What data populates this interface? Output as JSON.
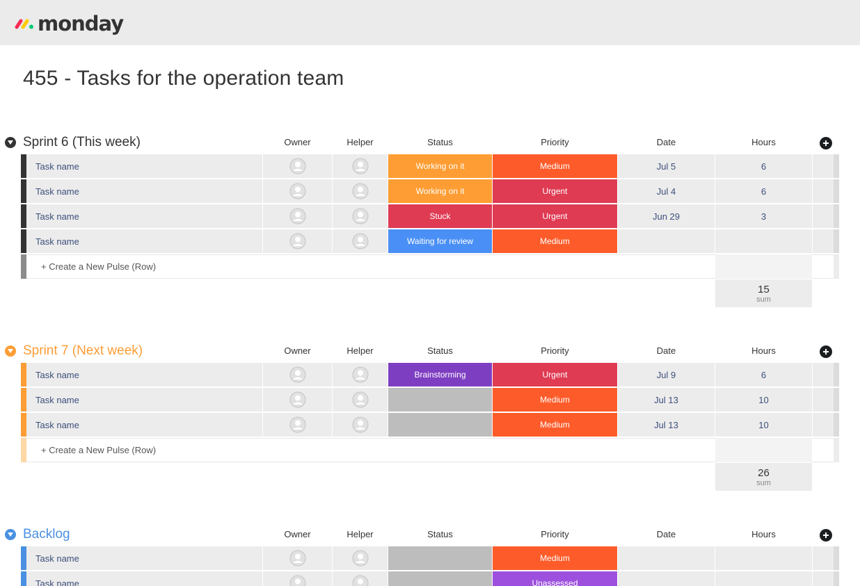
{
  "app": {
    "logo_text": "monday"
  },
  "board": {
    "title": "455 - Tasks for the operation team"
  },
  "columns": {
    "owner": "Owner",
    "helper": "Helper",
    "status": "Status",
    "priority": "Priority",
    "date": "Date",
    "hours": "Hours"
  },
  "colors": {
    "working": "#fd9d33",
    "stuck": "#df3b53",
    "review": "#4a8ff5",
    "brainstorming": "#7e3ec1",
    "empty": "#bdbdbd",
    "medium": "#fd5c2a",
    "urgent": "#df3b53",
    "unassessed": "#9d50dd",
    "sprint6": "#333333",
    "sprint7": "#fc9d35",
    "backlog": "#4a90e2"
  },
  "groups": [
    {
      "title": "Sprint 6 (This week)",
      "color": "#333333",
      "rows": [
        {
          "name": "Task name",
          "status": "Working on it",
          "priority": "Medium",
          "date": "Jul 5",
          "hours": "6"
        },
        {
          "name": "Task name",
          "status": "Working on it",
          "priority": "Urgent",
          "date": "Jul 4",
          "hours": "6"
        },
        {
          "name": "Task name",
          "status": "Stuck",
          "priority": "Urgent",
          "date": "Jun 29",
          "hours": "3"
        },
        {
          "name": "Task name",
          "status": "Waiting for review",
          "priority": "Medium",
          "date": "",
          "hours": ""
        }
      ],
      "new_row": "+ Create a New Pulse (Row)",
      "sum": {
        "value": "15",
        "label": "sum"
      }
    },
    {
      "title": "Sprint 7 (Next week)",
      "color": "#fc9d35",
      "rows": [
        {
          "name": "Task name",
          "status": "Brainstorming",
          "priority": "Urgent",
          "date": "Jul 9",
          "hours": "6"
        },
        {
          "name": "Task name",
          "status": "",
          "priority": "Medium",
          "date": "Jul 13",
          "hours": "10"
        },
        {
          "name": "Task name",
          "status": "",
          "priority": "Medium",
          "date": "Jul 13",
          "hours": "10"
        }
      ],
      "new_row": "+ Create a New Pulse (Row)",
      "sum": {
        "value": "26",
        "label": "sum"
      }
    },
    {
      "title": "Backlog",
      "color": "#4a90e2",
      "rows": [
        {
          "name": "Task name",
          "status": "",
          "priority": "Medium",
          "date": "",
          "hours": ""
        },
        {
          "name": "Task name",
          "status": "",
          "priority": "Unassessed",
          "date": "",
          "hours": ""
        }
      ]
    }
  ]
}
